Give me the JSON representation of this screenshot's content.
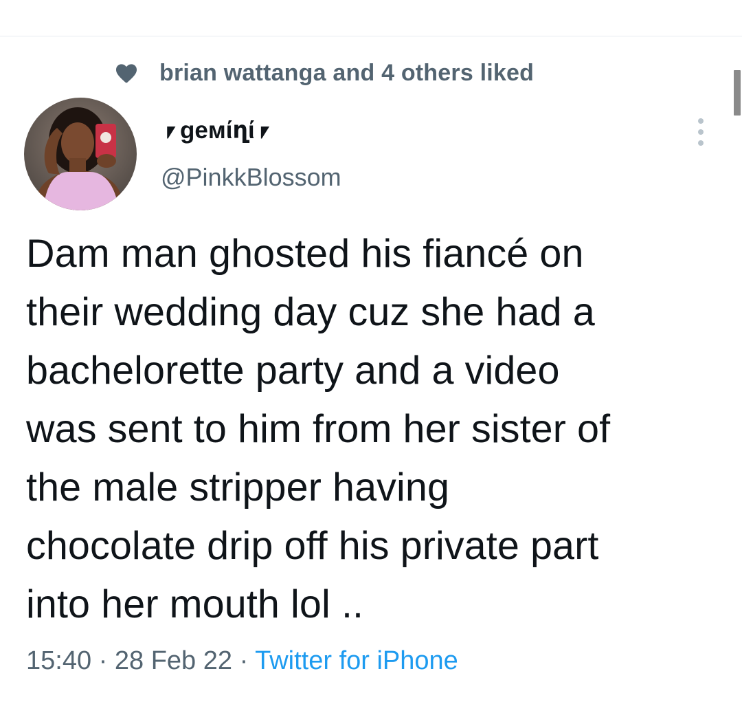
{
  "social_context": {
    "text": "brian wattanga and 4 others liked",
    "icon": "heart-icon"
  },
  "author": {
    "display_name": "⎖ɡeмίղί⎖",
    "handle": "@PinkkBlossom",
    "avatar": "avatar"
  },
  "tweet": {
    "text": "Dam man ghosted his fiancé on\ntheir wedding day cuz she had a\nbachelorette party and a video\nwas sent to him from her sister of\nthe male stripper having\nchocolate drip off his private part\ninto her mouth lol .."
  },
  "meta": {
    "time": "15:40",
    "separator1": " · ",
    "date": "28 Feb 22",
    "separator2": " · ",
    "source": "Twitter for iPhone"
  },
  "colors": {
    "text_primary": "#0f1419",
    "text_secondary": "#536471",
    "link": "#1d9bf0",
    "divider": "#e6ecf0"
  },
  "icons": {
    "more": "more-options-icon"
  }
}
